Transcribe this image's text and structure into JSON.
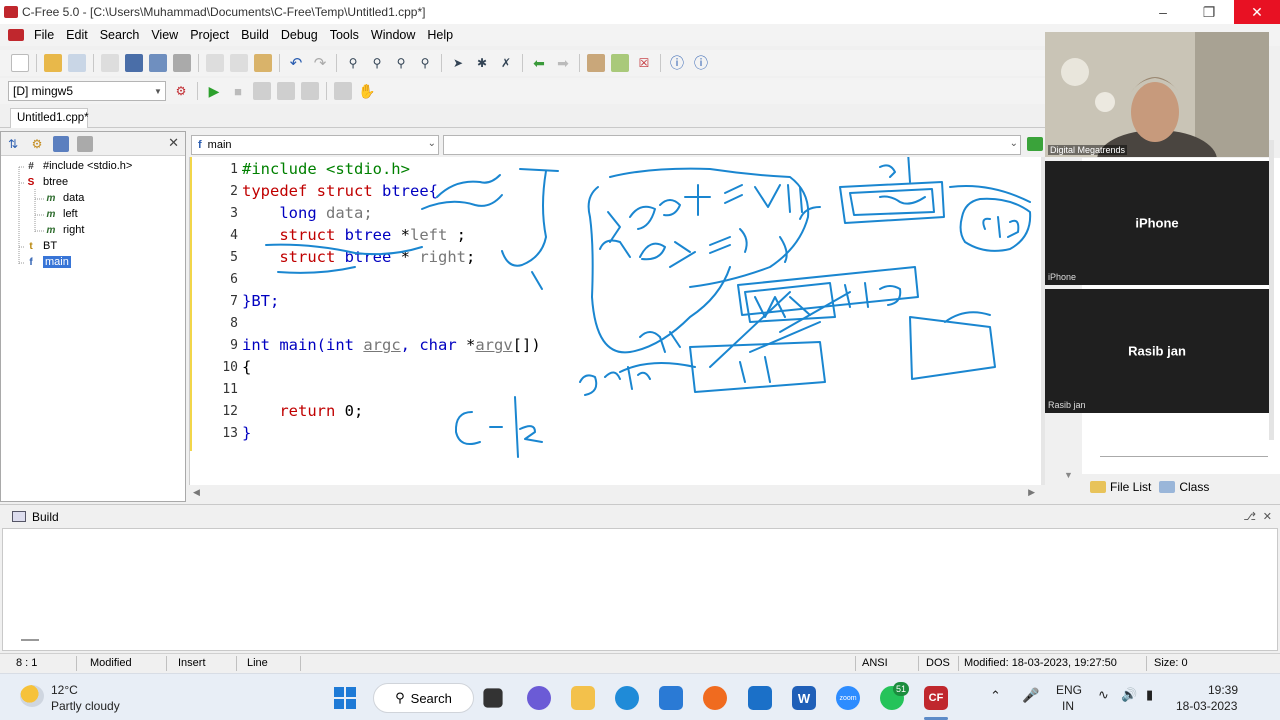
{
  "window": {
    "title": "C-Free 5.0 - [C:\\Users\\Muhammad\\Documents\\C-Free\\Temp\\Untitled1.cpp*]"
  },
  "menu": [
    "File",
    "Edit",
    "Search",
    "View",
    "Project",
    "Build",
    "Debug",
    "Tools",
    "Window",
    "Help"
  ],
  "toolbar": {
    "compiler": "[D] mingw5"
  },
  "tabs": {
    "active": "Untitled1.cpp*"
  },
  "tree": {
    "items": [
      {
        "label": "#include <stdio.h>",
        "icon": "hash-icon"
      },
      {
        "label": "btree",
        "icon": "struct-icon"
      },
      {
        "label": "data",
        "icon": "member-icon"
      },
      {
        "label": "left",
        "icon": "member-icon"
      },
      {
        "label": "right",
        "icon": "member-icon"
      },
      {
        "label": "BT",
        "icon": "typedef-icon"
      },
      {
        "label": "main",
        "icon": "function-icon"
      }
    ]
  },
  "editor": {
    "function_combo": "main",
    "scope_combo": "",
    "line_numbers": [
      "1",
      "2",
      "3",
      "4",
      "5",
      "6",
      "7",
      "8",
      "9",
      "10",
      "11",
      "12",
      "13"
    ],
    "lines": {
      "l1_pp": "#include <stdio.h>",
      "l2_kw": "typedef struct",
      "l2_rest": " btree{",
      "l3_ty": "long",
      "l3_var": " data;",
      "l4_kw": "struct",
      "l4_ty": " btree",
      "l4_rest": " *",
      "l4_var": "left",
      "l4_end": " ;",
      "l5_kw": "struct",
      "l5_ty": " btree",
      "l5_rest": " * ",
      "l5_var": "right",
      "l5_end": ";",
      "l7": "}BT;",
      "l9_ty1": "int",
      "l9_fn": " main(",
      "l9_ty2": "int",
      "l9_arg1": "argc",
      "l9_mid": ", ",
      "l9_ty3": "char",
      "l9_star": " *",
      "l9_arg2": "argv",
      "l9_end": "[])",
      "l10": "{",
      "l12_kw": "return",
      "l12_rest": " 0;",
      "l13": "}"
    }
  },
  "right_panel": {
    "tabs": [
      "File List",
      "Class"
    ]
  },
  "video": {
    "camera_caption": "Digital Megatrends",
    "tiles": [
      {
        "name": "iPhone",
        "caption": "iPhone"
      },
      {
        "name": "Rasib jan",
        "caption": "Rasib jan"
      }
    ]
  },
  "build": {
    "title": "Build"
  },
  "status": {
    "position": "8 : 1",
    "modified": "Modified",
    "insert": "Insert",
    "line": "Line",
    "encoding": "ANSI",
    "format": "DOS",
    "modified_time": "Modified: 18-03-2023, 19:27:50",
    "size": "Size: 0"
  },
  "taskbar": {
    "weather_temp": "12°C",
    "weather_desc": "Partly cloudy",
    "search": "Search",
    "lang1": "ENG",
    "lang2": "IN",
    "time": "19:39",
    "date": "18-03-2023",
    "whatsapp_badge": "51"
  },
  "colors": {
    "ink": "#1a86d0",
    "keyword": "#c00000",
    "type": "#0000c0",
    "preprocessor": "#008000"
  }
}
